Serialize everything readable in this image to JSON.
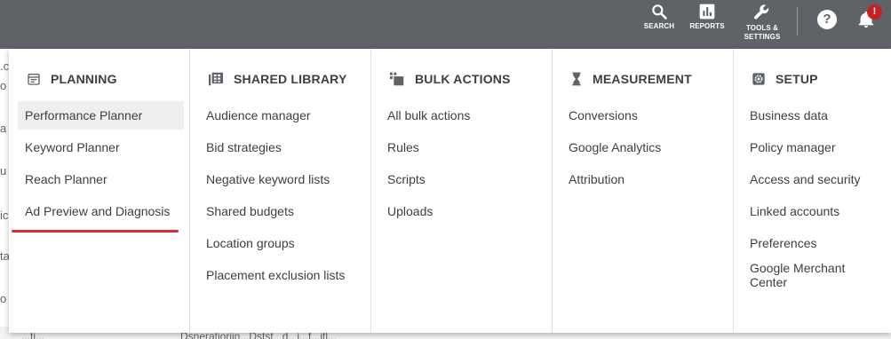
{
  "topbar": {
    "search_label": "SEARCH",
    "reports_label": "REPORTS",
    "tools_label": "TOOLS &\nSETTINGS",
    "help_glyph": "?",
    "notification_badge": "!",
    "icons": [
      "search-icon",
      "reports-icon",
      "wrench-icon",
      "help-icon",
      "bell-icon"
    ]
  },
  "background": {
    "left_fragments": [
      ".c",
      "o",
      "a",
      "u",
      "ic",
      "ta",
      "o"
    ],
    "bottom_left": "...ti...",
    "bottom_text": "Dsneratioriin...Dstst...d...i...f...itl..."
  },
  "columns": [
    {
      "title": "PLANNING",
      "icon": "calendar-icon",
      "items": [
        "Performance Planner",
        "Keyword Planner",
        "Reach Planner",
        "Ad Preview and Diagnosis"
      ]
    },
    {
      "title": "SHARED LIBRARY",
      "icon": "library-grid-icon",
      "items": [
        "Audience manager",
        "Bid strategies",
        "Negative keyword lists",
        "Shared budgets",
        "Location groups",
        "Placement exclusion lists"
      ]
    },
    {
      "title": "BULK ACTIONS",
      "icon": "copy-stack-icon",
      "items": [
        "All bulk actions",
        "Rules",
        "Scripts",
        "Uploads"
      ]
    },
    {
      "title": "MEASUREMENT",
      "icon": "hourglass-icon",
      "items": [
        "Conversions",
        "Google Analytics",
        "Attribution"
      ]
    },
    {
      "title": "SETUP",
      "icon": "settings-gear-icon",
      "items": [
        "Business data",
        "Policy manager",
        "Access and security",
        "Linked accounts",
        "Preferences",
        "Google Merchant Center"
      ]
    }
  ],
  "colors": {
    "topbar": "#5f6368",
    "highlight": "#efefef",
    "underline": "#d32f2f",
    "badge": "#c5221f"
  }
}
